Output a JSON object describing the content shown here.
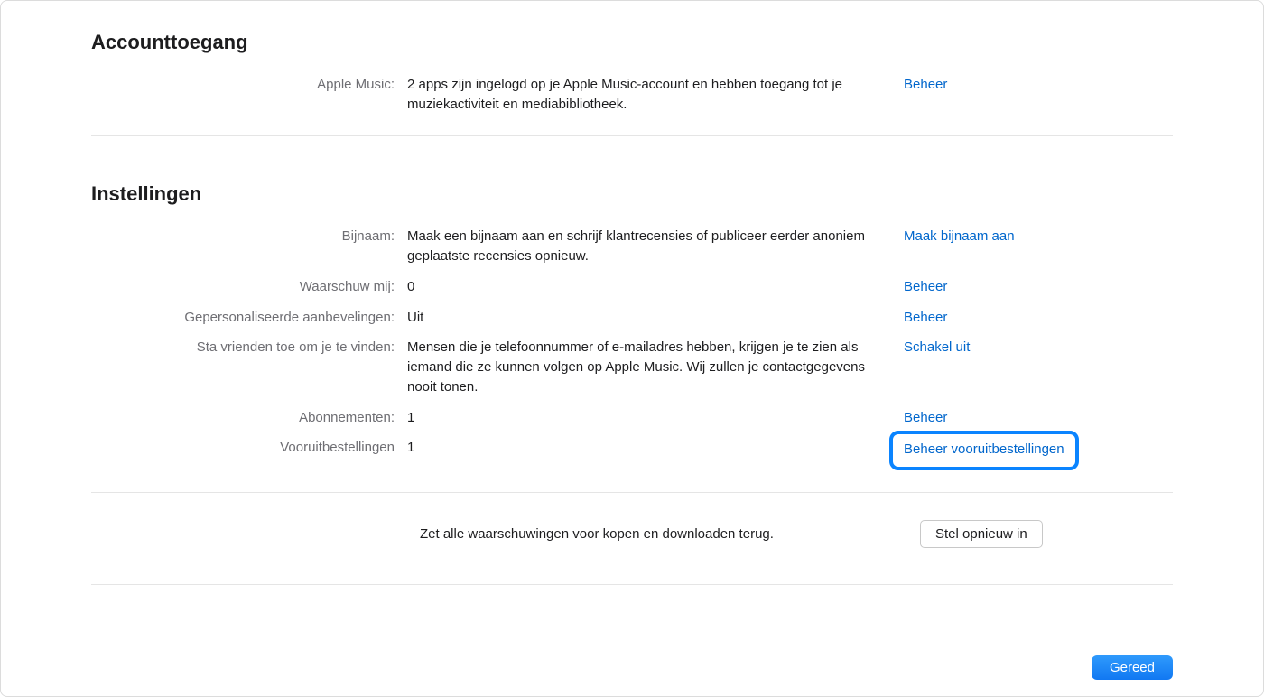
{
  "access": {
    "title": "Accounttoegang",
    "apple_music": {
      "label": "Apple Music:",
      "value": "2 apps zijn ingelogd op je Apple Music-account en hebben toegang tot je muziekactiviteit en mediabibliotheek.",
      "action": "Beheer"
    }
  },
  "settings": {
    "title": "Instellingen",
    "nickname": {
      "label": "Bijnaam:",
      "value": "Maak een bijnaam aan en schrijf klantrecensies of publiceer eerder anoniem geplaatste recensies opnieuw.",
      "action": "Maak bijnaam aan"
    },
    "alert_me": {
      "label": "Waarschuw mij:",
      "value": "0",
      "action": "Beheer"
    },
    "recommendations": {
      "label": "Gepersonaliseerde aanbevelingen:",
      "value": "Uit",
      "action": "Beheer"
    },
    "allow_friends": {
      "label": "Sta vrienden toe om je te vinden:",
      "value": "Mensen die je telefoonnummer of e-mailadres hebben, krijgen je te zien als iemand die ze kunnen volgen op Apple Music. Wij zullen je contactgegevens nooit tonen.",
      "action": "Schakel uit"
    },
    "subscriptions": {
      "label": "Abonnementen:",
      "value": "1",
      "action": "Beheer"
    },
    "preorders": {
      "label": "Vooruitbestellingen",
      "value": "1",
      "action": "Beheer vooruitbestellingen"
    }
  },
  "reset": {
    "text": "Zet alle waarschuwingen voor kopen en downloaden terug.",
    "button": "Stel opnieuw in"
  },
  "footer": {
    "done": "Gereed"
  }
}
